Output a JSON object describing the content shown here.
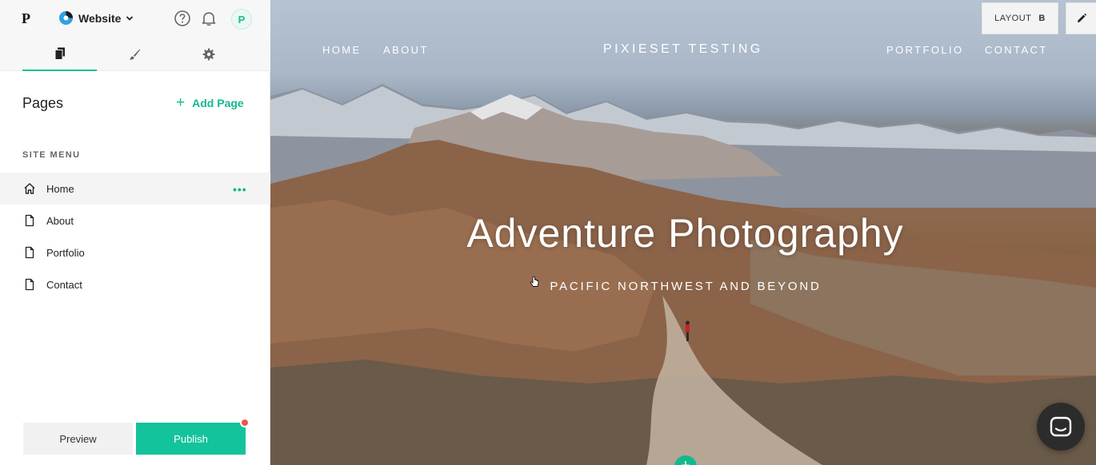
{
  "app": {
    "logo": "P",
    "site_name": "Website",
    "avatar_initial": "P"
  },
  "sidebar": {
    "tabs": [
      {
        "name": "pages",
        "icon": "pages-icon",
        "active": true
      },
      {
        "name": "design",
        "icon": "brush-icon",
        "active": false
      },
      {
        "name": "settings",
        "icon": "gear-icon",
        "active": false
      }
    ],
    "pages_title": "Pages",
    "add_page_label": "Add Page",
    "site_menu_label": "SITE MENU",
    "menu_items": [
      {
        "label": "Home",
        "icon": "home-icon",
        "selected": true
      },
      {
        "label": "About",
        "icon": "page-icon",
        "selected": false
      },
      {
        "label": "Portfolio",
        "icon": "page-icon",
        "selected": false
      },
      {
        "label": "Contact",
        "icon": "page-icon",
        "selected": false
      }
    ],
    "preview_label": "Preview",
    "publish_label": "Publish"
  },
  "preview": {
    "nav_left": [
      "HOME",
      "ABOUT"
    ],
    "brand": "PIXIESET TESTING",
    "nav_right": [
      "PORTFOLIO",
      "CONTACT"
    ],
    "hero_title": "Adventure Photography",
    "hero_subtitle": "PACIFIC NORTHWEST AND BEYOND",
    "layout_label": "LAYOUT",
    "layout_value": "B"
  },
  "colors": {
    "accent": "#13c39b",
    "notification": "#f05454"
  }
}
